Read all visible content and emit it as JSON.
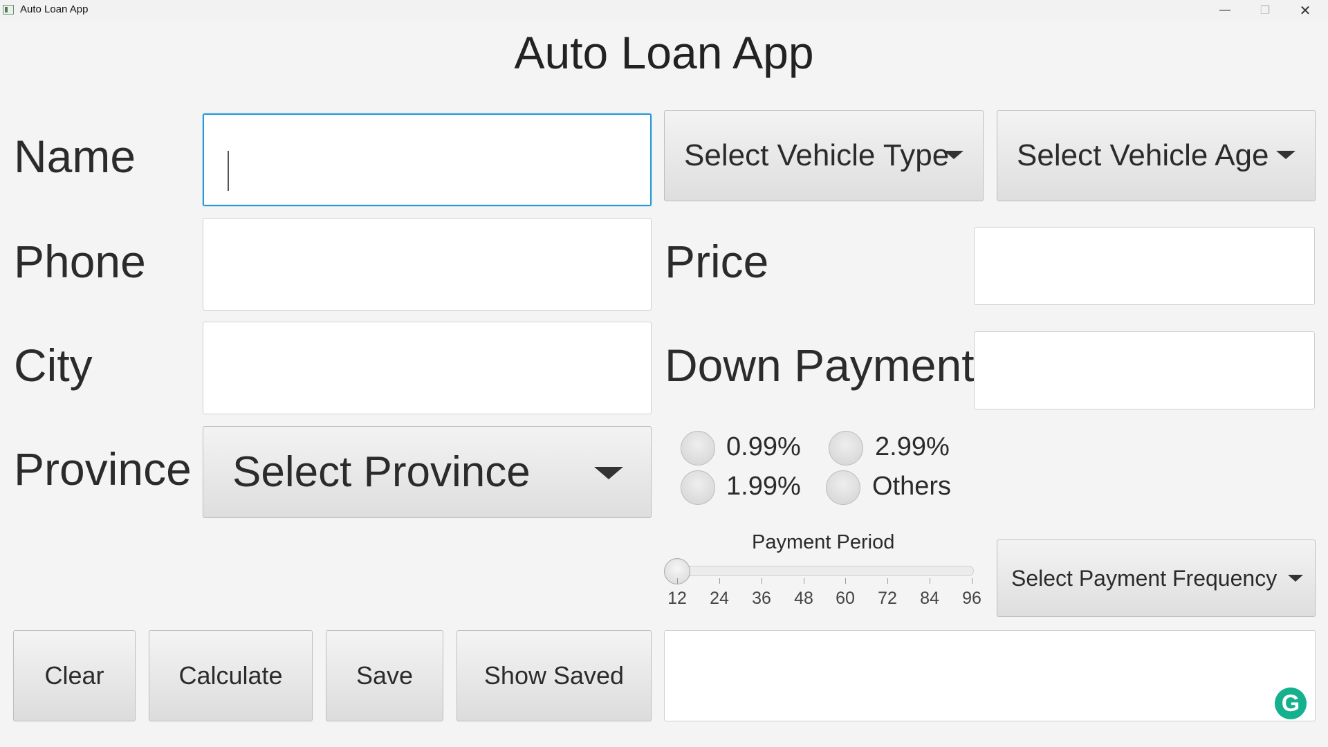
{
  "window": {
    "title": "Auto Loan App",
    "icons": {
      "app": "app-window-icon",
      "minimize": "minimize-icon",
      "maximize": "maximize-icon",
      "close": "close-icon"
    }
  },
  "app": {
    "heading": "Auto Loan App"
  },
  "form": {
    "name_label": "Name",
    "phone_label": "Phone",
    "city_label": "City",
    "province_label": "Province",
    "name_value": "",
    "phone_value": "",
    "city_value": "",
    "province_select": "Select Province"
  },
  "vehicle": {
    "type_select": "Select Vehicle Type",
    "age_select": "Select Vehicle Age",
    "price_label": "Price",
    "down_payment_label": "Down Payment",
    "price_value": "",
    "down_payment_value": ""
  },
  "rates": {
    "options": [
      "0.99%",
      "2.99%",
      "1.99%",
      "Others"
    ],
    "selected": null
  },
  "payment": {
    "period_label": "Payment Period",
    "period_ticks": [
      "12",
      "24",
      "36",
      "48",
      "60",
      "72",
      "84",
      "96"
    ],
    "period_value": 12,
    "frequency_select": "Select Payment Frequency"
  },
  "buttons": {
    "clear": "Clear",
    "calculate": "Calculate",
    "save": "Save",
    "show_saved": "Show Saved"
  },
  "output": {
    "text": ""
  },
  "colors": {
    "focus": "#2a9ad6",
    "background": "#f4f4f4",
    "grammarly": "#15b18f"
  }
}
